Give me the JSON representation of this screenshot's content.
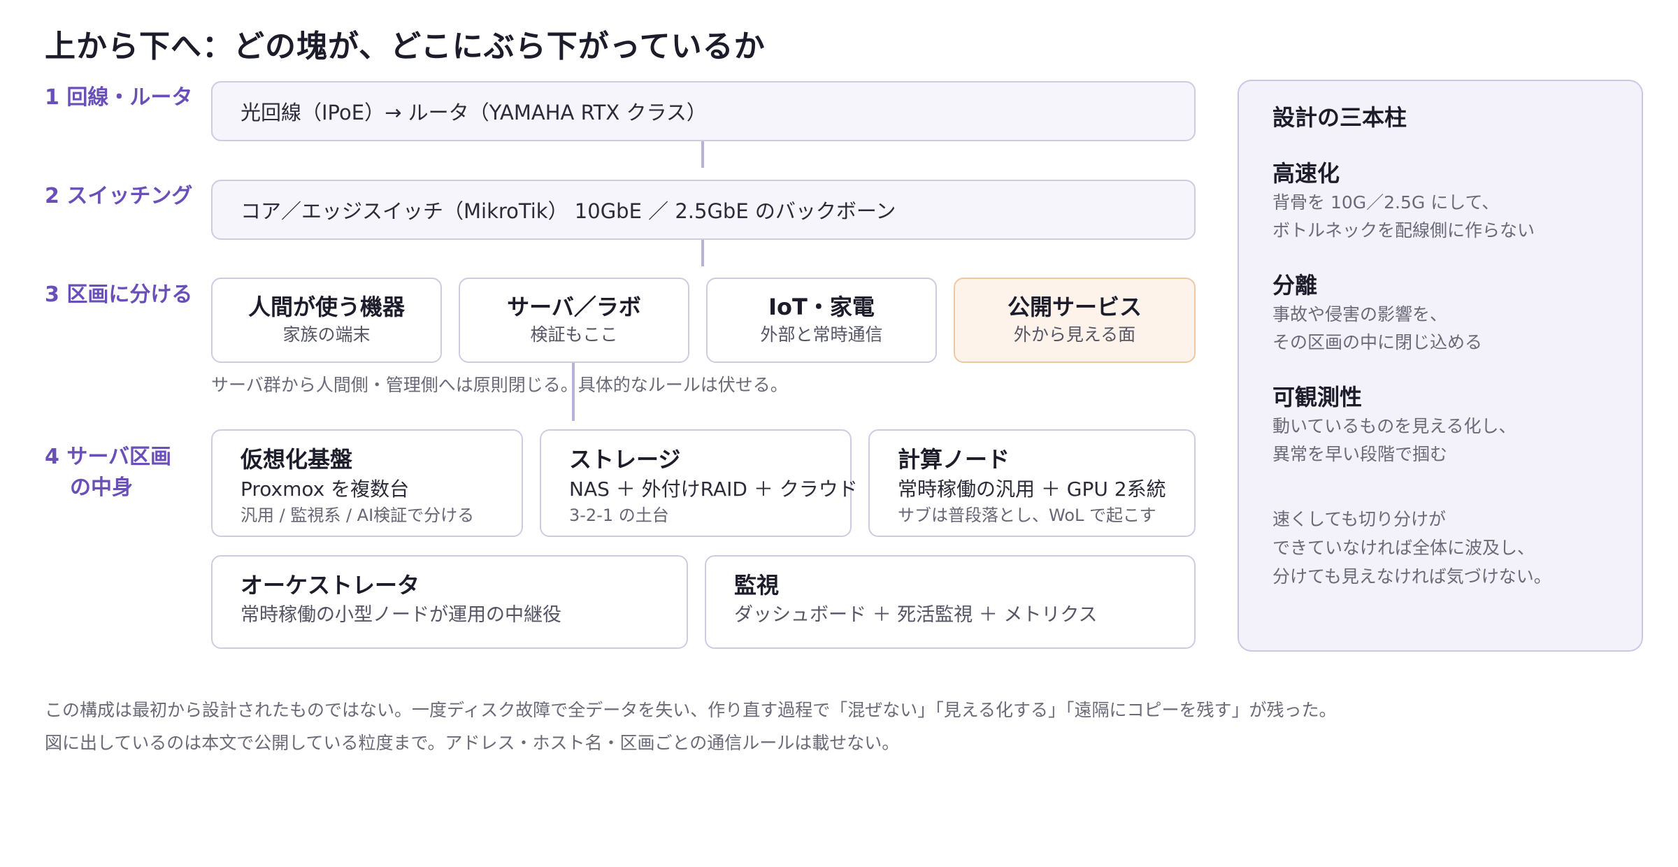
{
  "title": "上から下へ：どの塊が、どこにぶら下がっているか",
  "tiers": {
    "t1": "1 回線・ルータ",
    "t2": "2 スイッチング",
    "t3": "3 区画に分ける",
    "t4_line1": "4 サーバ区画",
    "t4_line2": "の中身"
  },
  "row1": "光回線（IPoE）→ ルータ（YAMAHA RTX クラス）",
  "row2": "コア／エッジスイッチ（MikroTik） 10GbE ／ 2.5GbE のバックボーン",
  "segments": [
    {
      "title": "人間が使う機器",
      "sub": "家族の端末"
    },
    {
      "title": "サーバ／ラボ",
      "sub": "検証もここ"
    },
    {
      "title": "IoT・家電",
      "sub": "外部と常時通信"
    },
    {
      "title": "公開サービス",
      "sub": "外から見える面"
    }
  ],
  "segment_note": "サーバ群から人間側・管理側へは原則閉じる。具体的なルールは伏せる。",
  "nodes": [
    {
      "title": "仮想化基盤",
      "desc": "Proxmox を複数台",
      "sub": "汎用 / 監視系 / AI検証で分ける"
    },
    {
      "title": "ストレージ",
      "desc": "NAS ＋ 外付けRAID ＋ クラウド",
      "sub": "3-2-1 の土台"
    },
    {
      "title": "計算ノード",
      "desc": "常時稼働の汎用 ＋ GPU 2系統",
      "sub": "サブは普段落とし、WoL で起こす"
    },
    {
      "title": "オーケストレータ",
      "desc": "常時稼働の小型ノードが運用の中継役"
    },
    {
      "title": "監視",
      "desc": "ダッシュボード ＋ 死活監視 ＋ メトリクス"
    }
  ],
  "side": {
    "heading": "設計の三本柱",
    "pillars": [
      {
        "name": "高速化",
        "lines": [
          "背骨を 10G／2.5G にして、",
          "ボトルネックを配線側に作らない"
        ]
      },
      {
        "name": "分離",
        "lines": [
          "事故や侵害の影響を、",
          "その区画の中に閉じ込める"
        ]
      },
      {
        "name": "可観測性",
        "lines": [
          "動いているものを見える化し、",
          "異常を早い段階で掴む"
        ]
      }
    ],
    "summary": [
      "速くしても切り分けが",
      "できていなければ全体に波及し、",
      "分けても見えなければ気づけない。"
    ]
  },
  "footer": [
    "この構成は最初から設計されたものではない。一度ディスク故障で全データを失い、作り直す過程で「混ぜない」「見える化する」「遠隔にコピーを残す」が残った。",
    "図に出しているのは本文で公開している粒度まで。アドレス・ホスト名・区画ごとの通信ルールは載せない。"
  ],
  "colors": {
    "accent": "#6a4fb8",
    "box_border": "#cfcbe0",
    "public_fill": "#fdf3ea",
    "public_border": "#ecc9a4",
    "panel_fill": "#f3f1fa"
  }
}
